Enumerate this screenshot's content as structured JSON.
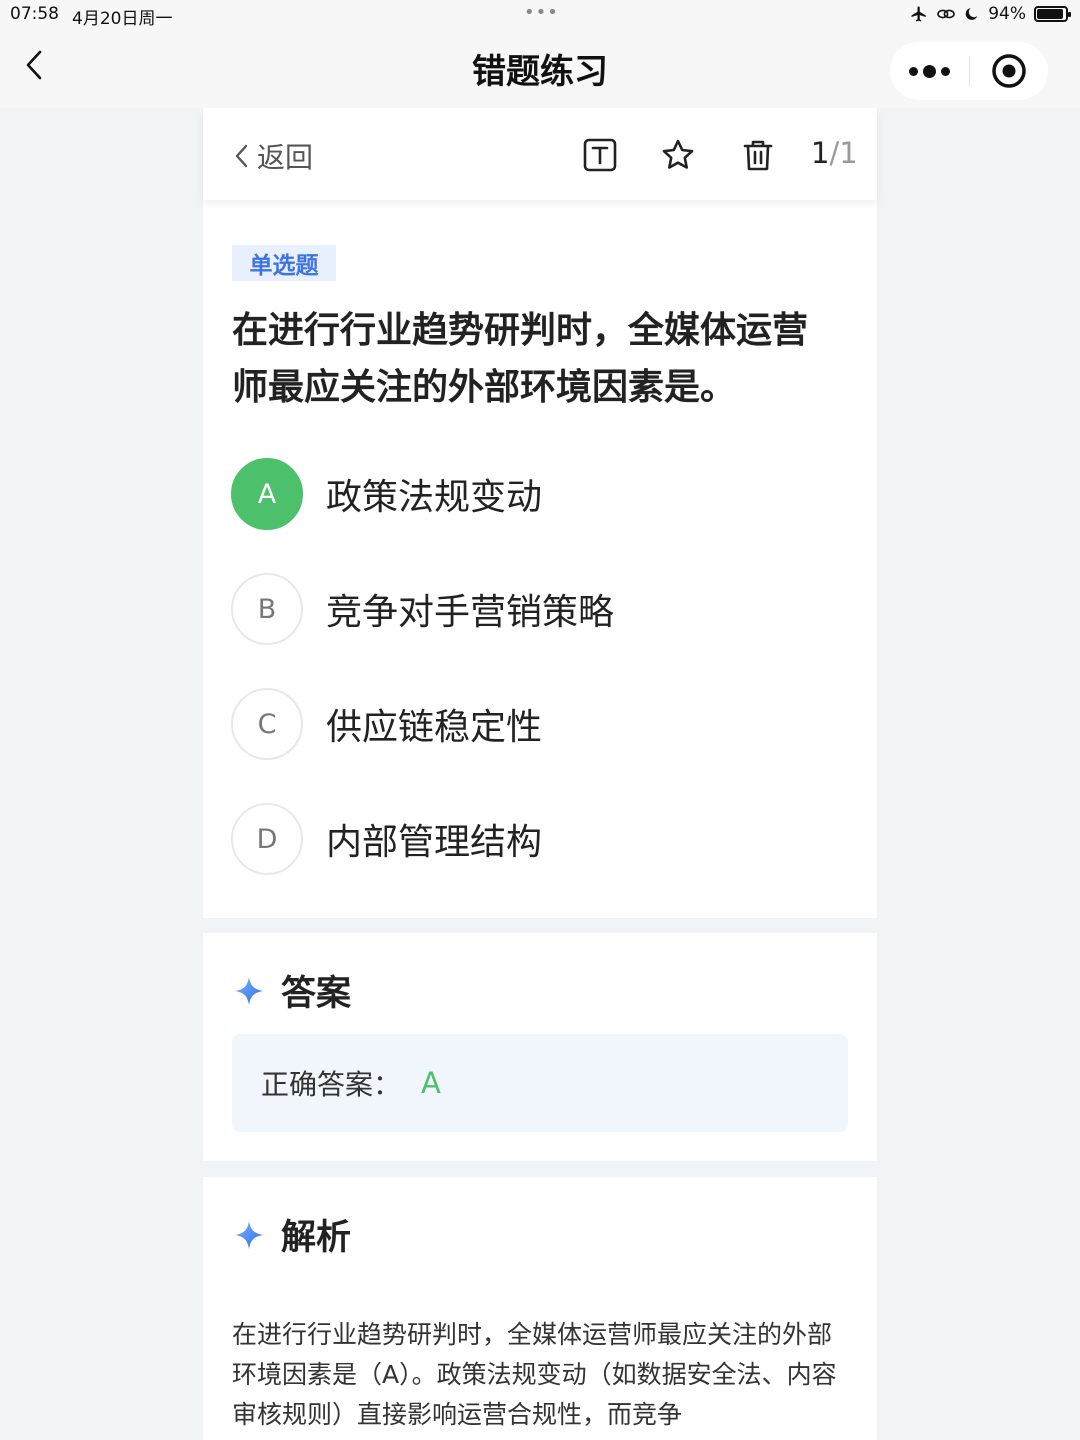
{
  "status_bar": {
    "time": "07:58",
    "date": "4月20日周一",
    "center_dots": "•••",
    "battery_percent": "94%",
    "battery_level": 0.94
  },
  "nav": {
    "title": "错题练习"
  },
  "toolbar": {
    "back_label": "返回",
    "page_current": "1",
    "page_sep": "/",
    "page_total": "1"
  },
  "question": {
    "type_badge": "单选题",
    "text": "在进行行业趋势研判时，全媒体运营师最应关注的外部环境因素是。",
    "options": [
      {
        "letter": "A",
        "text": "政策法规变动",
        "state": "correct"
      },
      {
        "letter": "B",
        "text": "竞争对手营销策略",
        "state": "normal"
      },
      {
        "letter": "C",
        "text": "供应链稳定性",
        "state": "normal"
      },
      {
        "letter": "D",
        "text": "内部管理结构",
        "state": "normal"
      }
    ]
  },
  "answer": {
    "title": "答案",
    "label": "正确答案：",
    "value": "A"
  },
  "analysis": {
    "title": "解析",
    "text": "在进行行业趋势研判时，全媒体运营师最应关注的外部环境因素是（A）。政策法规变动（如数据安全法、内容审核规则）直接影响运营合规性，而竞争"
  },
  "colors": {
    "correct": "#4cc06b",
    "accent_blue": "#3c74e6",
    "badge_bg": "#e8effd"
  },
  "icons": [
    "chevron-left-icon",
    "airplane-icon",
    "link-icon",
    "moon-icon",
    "battery-icon",
    "more-dots-icon",
    "target-icon",
    "text-mode-icon",
    "star-icon",
    "trash-icon",
    "sparkle-icon"
  ]
}
